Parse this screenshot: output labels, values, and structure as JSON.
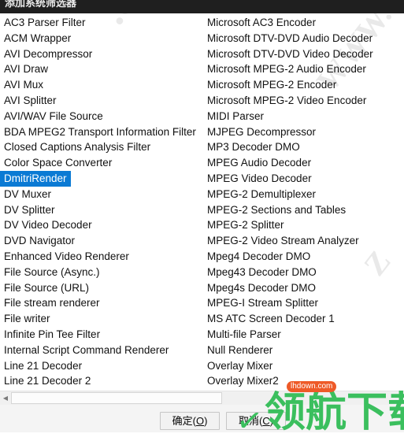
{
  "window": {
    "title": "添加系统筛选器"
  },
  "filter_list": {
    "selected_item": "DmitriRender",
    "left_column": [
      "AC3 Parser Filter",
      "ACM Wrapper",
      "AVI Decompressor",
      "AVI Draw",
      "AVI Mux",
      "AVI Splitter",
      "AVI/WAV File Source",
      "BDA MPEG2 Transport Information Filter",
      "Closed Captions Analysis Filter",
      "Color Space Converter",
      "DmitriRender",
      "DV Muxer",
      "DV Splitter",
      "DV Video Decoder",
      "DVD Navigator",
      "Enhanced Video Renderer",
      "File Source (Async.)",
      "File Source (URL)",
      "File stream renderer",
      "File writer",
      "Infinite Pin Tee Filter",
      "Internal Script Command Renderer",
      "Line 21 Decoder",
      "Line 21 Decoder 2"
    ],
    "right_column": [
      "Microsoft AC3 Encoder",
      "Microsoft DTV-DVD Audio Decoder",
      "Microsoft DTV-DVD Video Decoder",
      "Microsoft MPEG-2 Audio Encoder",
      "Microsoft MPEG-2 Encoder",
      "Microsoft MPEG-2 Video Encoder",
      "MIDI Parser",
      "MJPEG Decompressor",
      "MP3 Decoder DMO",
      "MPEG Audio Decoder",
      "MPEG Video Decoder",
      "MPEG-2 Demultiplexer",
      "MPEG-2 Sections and Tables",
      "MPEG-2 Splitter",
      "MPEG-2 Video Stream Analyzer",
      "Mpeg4 Decoder DMO",
      "Mpeg43 Decoder DMO",
      "Mpeg4s Decoder DMO",
      "MPEG-I Stream Splitter",
      "MS ATC Screen Decoder 1",
      "Multi-file Parser",
      "Null Renderer",
      "Overlay Mixer",
      "Overlay Mixer2"
    ]
  },
  "scrollbar": {
    "left_arrow_glyph": "◀"
  },
  "buttons": {
    "ok_label": "确定(",
    "ok_mnemonic": "O",
    "ok_suffix": ")",
    "cancel_label": "取消(",
    "cancel_mnemonic": "C",
    "cancel_suffix": ")"
  },
  "watermarks": {
    "diagonal_a": ".com",
    "diagonal_b": "WWW.",
    "diagonal_c": "Z",
    "logo_text": "领航下载",
    "logo_badge": "lhdown.com",
    "check_glyph": "✓"
  },
  "colors": {
    "selection_blue": "#0b7ad4",
    "titlebar_dark": "#1f1f1f",
    "logo_green": "#3bbf5e",
    "badge_orange": "#ee5a28"
  }
}
